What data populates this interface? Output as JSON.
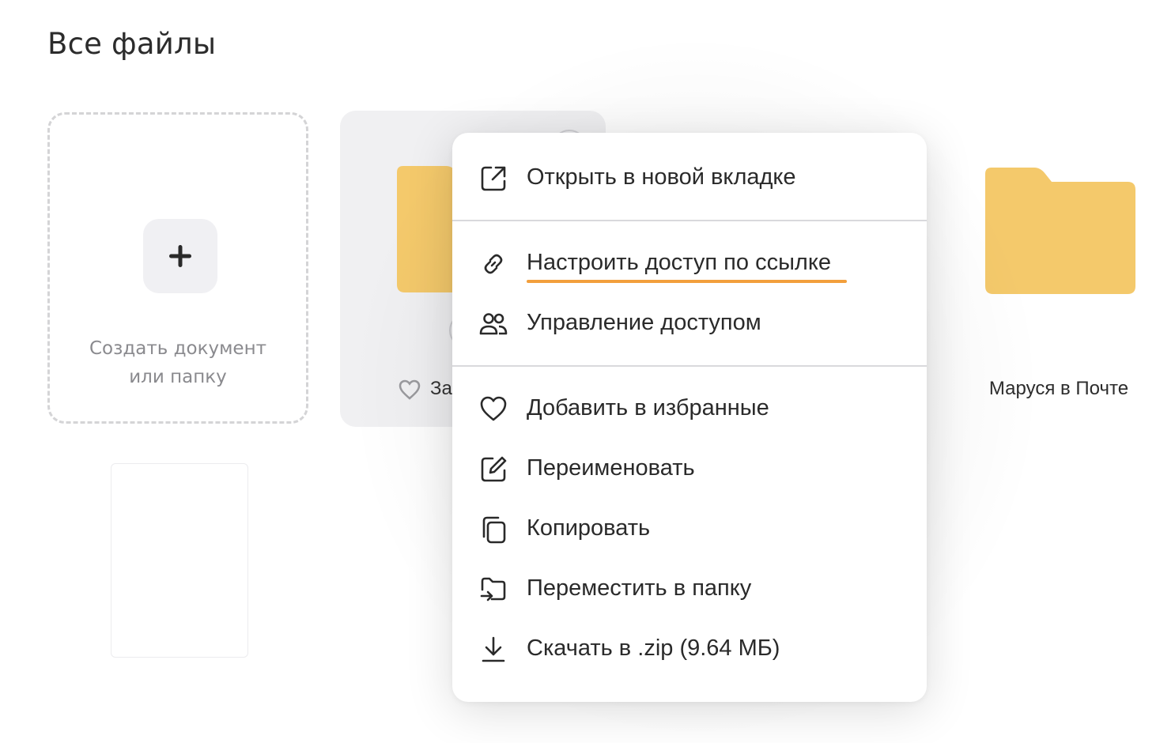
{
  "page": {
    "title": "Все файлы"
  },
  "create_card": {
    "label_line1": "Создать документ",
    "label_line2": "или папку"
  },
  "folder_card": {
    "name_partial": "За"
  },
  "folder_right": {
    "name": "Маруся в Почте"
  },
  "colors": {
    "folder": "#f4c96b",
    "folder_dark": "#eebb55",
    "accent_underline": "#f29f3c"
  },
  "context_menu": {
    "items": [
      {
        "label": "Открыть в новой вкладке",
        "icon": "external-link-icon"
      },
      {
        "label": "Настроить доступ по ссылке",
        "icon": "link-icon"
      },
      {
        "label": "Управление доступом",
        "icon": "users-icon"
      },
      {
        "label": "Добавить в избранные",
        "icon": "heart-icon"
      },
      {
        "label": "Переименовать",
        "icon": "edit-icon"
      },
      {
        "label": "Копировать",
        "icon": "copy-icon"
      },
      {
        "label": "Переместить в папку",
        "icon": "move-folder-icon"
      },
      {
        "label": "Скачать в .zip (9.64 МБ)",
        "icon": "download-icon"
      }
    ]
  }
}
